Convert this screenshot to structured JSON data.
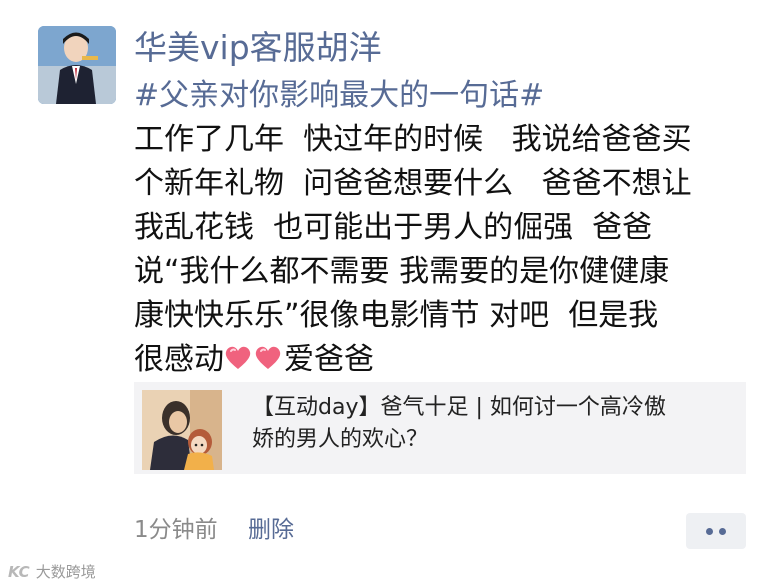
{
  "post": {
    "username": "华美vip客服胡洋",
    "hashtag": "#父亲对你影响最大的一句话#",
    "lines": [
      "工作了几年  快过年的时候   我说给爸爸买",
      "个新年礼物  问爸爸想要什么   爸爸不想让",
      "我乱花钱  也可能出于男人的倔强  爸爸",
      "说“我什么都不需要 我需要的是你健健康",
      "康快快乐乐”很像电影情节 对吧  但是我",
      "很感动"
    ],
    "closing_text": "爱爸爸",
    "emoji": [
      "heart-icon",
      "heart-icon"
    ]
  },
  "shared_article": {
    "title_line1": "【互动day】爸气十足 | 如何讨一个高冷傲",
    "title_line2": "娇的男人的欢心？"
  },
  "footer": {
    "timestamp": "1分钟前",
    "delete_label": "删除",
    "more_icon": "more-dots-icon"
  },
  "watermark": {
    "logo": "KC",
    "text": "大数跨境"
  },
  "colors": {
    "link": "#576b95",
    "text": "#111111",
    "muted": "#8a8a8a",
    "card_bg": "#f3f3f5",
    "heart": "#f0627e"
  }
}
